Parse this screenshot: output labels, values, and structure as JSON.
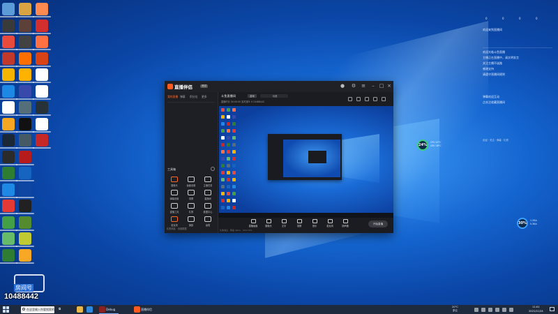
{
  "watermark": {
    "room_number": "10488442",
    "tag": "斗鱼",
    "sub": "房间号"
  },
  "app": {
    "title": "直播伴侣",
    "badge": "测试",
    "sidebar": {
      "tabs": [
        "我的直播",
        "弹幕",
        "积分位",
        "更多"
      ],
      "toolbar_title": "工具箱",
      "tools": [
        "摄像头",
        "画面设置",
        "主播任务",
        "弹幕设置",
        "录屏",
        "直播间",
        "直播工具",
        "礼物",
        "数据中心",
        "麦克风",
        "美颜",
        "画笔"
      ],
      "footer": "礼物消息 · 设置数据"
    },
    "main": {
      "room_title": "斗鱼直播间",
      "room_tag": "游戏",
      "room_input": "标题",
      "room_meta": "直播时长 00:00:00  实时观众 0  10488442",
      "bottom_tools": [
        "直播画面",
        "摄像头",
        "文字",
        "录屏",
        "音乐",
        "麦克风",
        "扬声器"
      ],
      "start_button": "开始直播",
      "status": "礼物消息 · 网速 0kb/s · CPU 15%"
    }
  },
  "panel": {
    "stats": [
      "0",
      "0",
      "0",
      "0"
    ],
    "lines": [
      "欢迎来到直播间",
      "欢迎光临斗鱼直播",
      "主播正在直播中，请文明发言",
      "关注主播不迷路",
      "感谢支持",
      "请遵守直播间规则",
      "弹幕欢迎互动",
      "点关注收藏直播间"
    ],
    "footer": "欢迎 · 关注 · 弹幕 · 礼物"
  },
  "perf_widgets": [
    {
      "value": "24",
      "unit": "%",
      "lines": [
        "CPU 45°C",
        "GPU 38°C"
      ],
      "ring_color": "#3ad07a"
    },
    {
      "value": "30",
      "unit": "%",
      "lines": [
        "1.2K/s",
        "0.3K/s"
      ],
      "ring_color": "#3aa0ff"
    }
  ],
  "taskbar": {
    "search_placeholder": "在这里输入你要搜索的内容",
    "task_view": "⧉",
    "open_app": "Debug",
    "open_app_2": "直播伴侣",
    "weather": {
      "temp": "20°C",
      "desc": "多云"
    },
    "clock": {
      "time": "11:01",
      "date": "2021/11/24"
    }
  },
  "colors": {
    "accent": "#ff6a2a",
    "desktop": "#1464cf",
    "taskbar": "#1e2a3e"
  }
}
